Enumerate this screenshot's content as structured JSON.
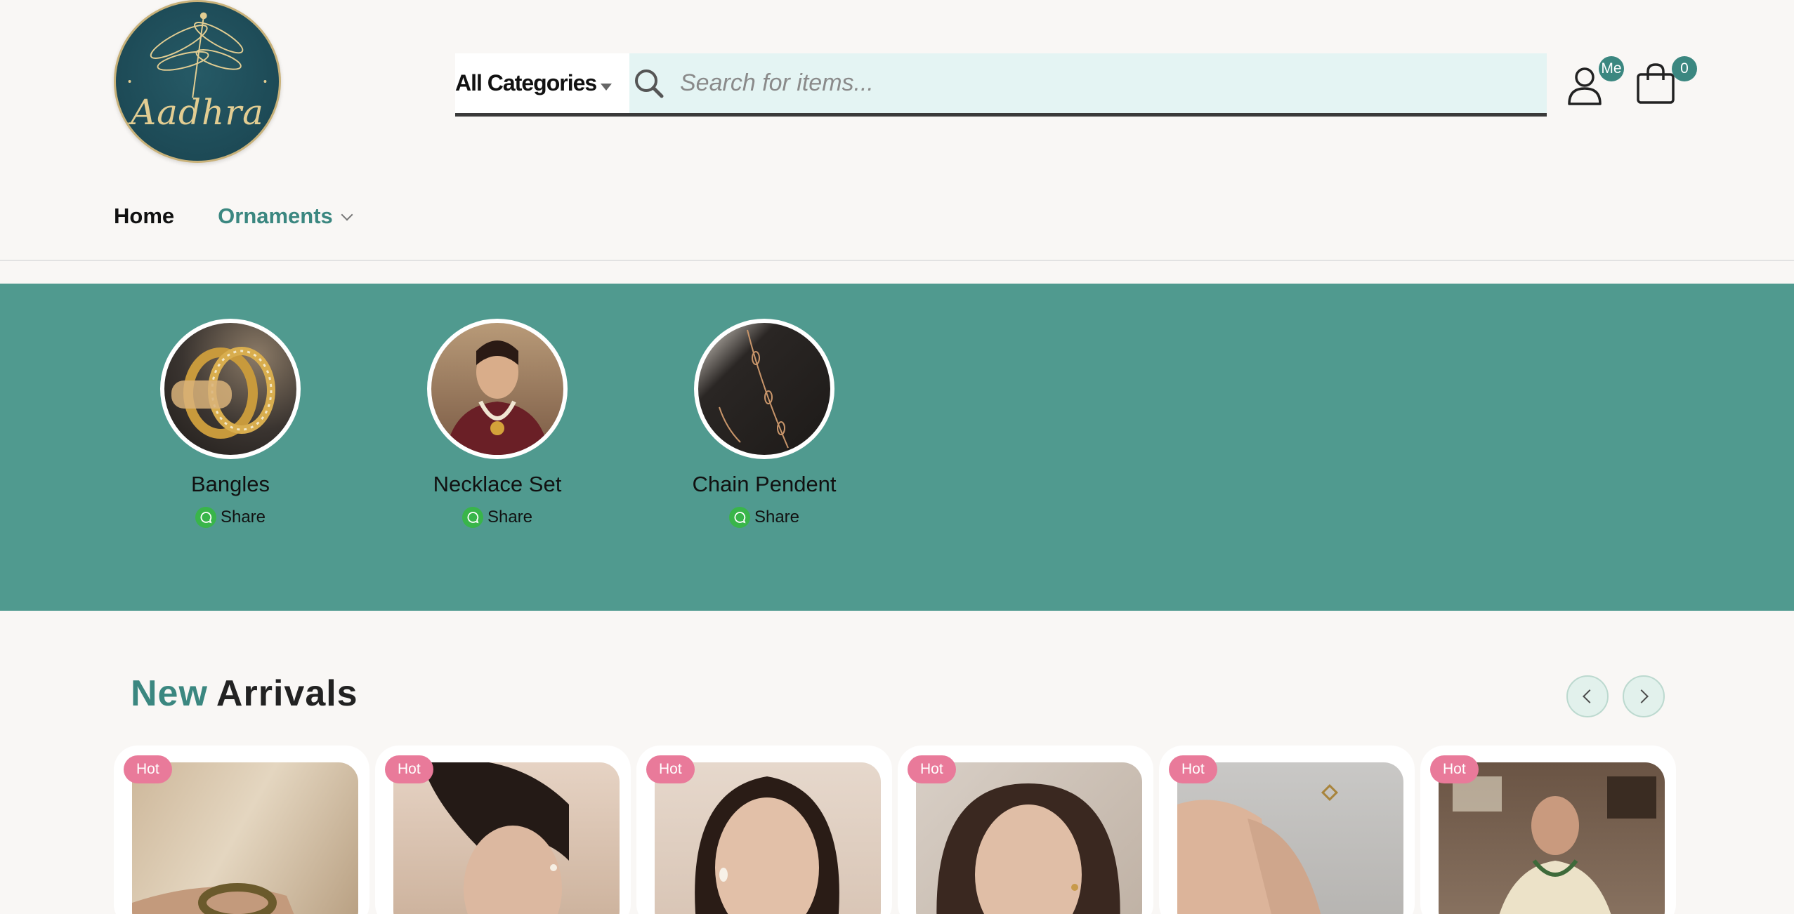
{
  "brand": {
    "logo_text": "Aadhra"
  },
  "search": {
    "category_label": "All Categories",
    "placeholder": "Search for items..."
  },
  "account": {
    "badge": "Me"
  },
  "cart": {
    "count": "0"
  },
  "nav": {
    "home": "Home",
    "ornaments": "Ornaments"
  },
  "categories": [
    {
      "name": "Bangles",
      "share": "Share"
    },
    {
      "name": "Necklace Set",
      "share": "Share"
    },
    {
      "name": "Chain Pendent",
      "share": "Share"
    }
  ],
  "new_arrivals": {
    "title_highlight": "New",
    "title_rest": "Arrivals",
    "products": [
      {
        "badge": "Hot"
      },
      {
        "badge": "Hot"
      },
      {
        "badge": "Hot"
      },
      {
        "badge": "Hot"
      },
      {
        "badge": "Hot"
      },
      {
        "badge": "Hot"
      }
    ]
  },
  "colors": {
    "accent": "#3b8780",
    "band": "#509a8f",
    "search_bg": "#e4f4f3",
    "hot_badge": "#e97a9a",
    "whatsapp": "#39b54a"
  },
  "icons": {
    "search": "search-icon",
    "user": "user-icon",
    "cart": "shopping-bag-icon",
    "share": "whatsapp-icon",
    "prev": "chevron-left-icon",
    "next": "chevron-right-icon"
  }
}
